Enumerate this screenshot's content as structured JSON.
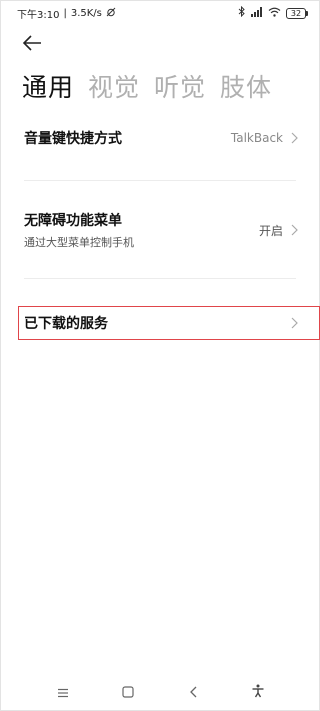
{
  "status_bar": {
    "time": "下午3:10",
    "separator": "|",
    "network_speed": "3.5K/s",
    "battery": "32"
  },
  "header": {
    "back_icon": "arrow-left-icon"
  },
  "tabs": [
    {
      "label": "通用",
      "active": true
    },
    {
      "label": "视觉",
      "active": false
    },
    {
      "label": "听觉",
      "active": false
    },
    {
      "label": "肢体",
      "active": false
    }
  ],
  "settings": {
    "volume_shortcut": {
      "label": "音量键快捷方式",
      "value": "TalkBack"
    },
    "accessibility_menu": {
      "label": "无障碍功能菜单",
      "sublabel": "通过大型菜单控制手机",
      "value": "开启"
    },
    "downloaded_services": {
      "label": "已下载的服务"
    }
  },
  "colors": {
    "highlight": "#e0454a",
    "inactive_tab": "#b0b0b0"
  },
  "nav_bar": {
    "menu_icon": "menu-icon",
    "home_icon": "home-square-icon",
    "back_icon": "back-chevron-icon",
    "accessibility_icon": "accessibility-person-icon"
  }
}
